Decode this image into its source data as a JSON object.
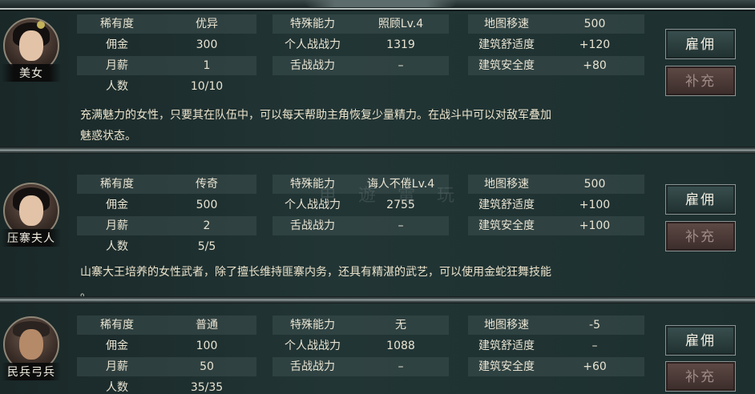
{
  "units": [
    {
      "name": "美女",
      "left": [
        {
          "k": "稀有度",
          "v": "优异"
        },
        {
          "k": "佣金",
          "v": "300"
        },
        {
          "k": "月薪",
          "v": "1"
        },
        {
          "k": "人数",
          "v": "10/10"
        }
      ],
      "mid": [
        {
          "k": "特殊能力",
          "v": "照顾Lv.4"
        },
        {
          "k": "个人战战力",
          "v": "1319"
        },
        {
          "k": "舌战战力",
          "v": "–"
        }
      ],
      "right": [
        {
          "k": "地图移速",
          "v": "500"
        },
        {
          "k": "建筑舒适度",
          "v": "+120"
        },
        {
          "k": "建筑安全度",
          "v": "+80"
        }
      ],
      "desc_line1": "充满魅力的女性，只要其在队伍中，可以每天帮助主角恢复少量精力。在战斗中可以对敌军叠加",
      "desc_line2": "魅惑状态。",
      "hire_label": "雇佣",
      "supplement_label": "补充"
    },
    {
      "name": "压寨夫人",
      "left": [
        {
          "k": "稀有度",
          "v": "传奇"
        },
        {
          "k": "佣金",
          "v": "500"
        },
        {
          "k": "月薪",
          "v": "2"
        },
        {
          "k": "人数",
          "v": "5/5"
        }
      ],
      "mid": [
        {
          "k": "特殊能力",
          "v": "诲人不倦Lv.4"
        },
        {
          "k": "个人战战力",
          "v": "2755"
        },
        {
          "k": "舌战战力",
          "v": "–"
        }
      ],
      "right": [
        {
          "k": "地图移速",
          "v": "500"
        },
        {
          "k": "建筑舒适度",
          "v": "+100"
        },
        {
          "k": "建筑安全度",
          "v": "+100"
        }
      ],
      "desc_line1": "山寨大王培养的女性武者，除了擅长维持匪寨内务，还具有精湛的武艺，可以使用金蛇狂舞技能",
      "desc_line2": "。",
      "hire_label": "雇佣",
      "supplement_label": "补充"
    },
    {
      "name": "民兵弓兵",
      "left": [
        {
          "k": "稀有度",
          "v": "普通"
        },
        {
          "k": "佣金",
          "v": "100"
        },
        {
          "k": "月薪",
          "v": "50"
        },
        {
          "k": "人数",
          "v": "35/35"
        }
      ],
      "mid": [
        {
          "k": "特殊能力",
          "v": "无"
        },
        {
          "k": "个人战战力",
          "v": "1088"
        },
        {
          "k": "舌战战力",
          "v": "–"
        }
      ],
      "right": [
        {
          "k": "地图移速",
          "v": "-5"
        },
        {
          "k": "建筑舒适度",
          "v": "–"
        },
        {
          "k": "建筑安全度",
          "v": "+60"
        }
      ],
      "hire_label": "雇佣",
      "supplement_label": "补充"
    }
  ],
  "watermark": "电 遊 電 玩"
}
